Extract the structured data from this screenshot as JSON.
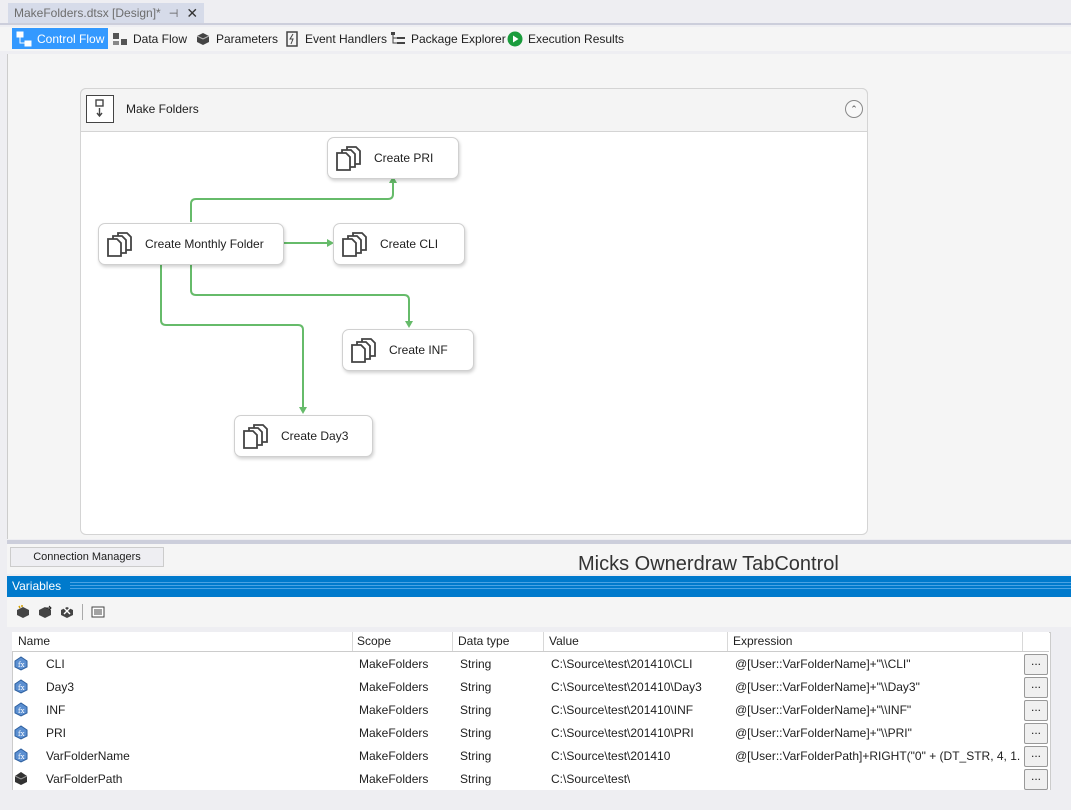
{
  "document": {
    "tab_title": "MakeFolders.dtsx [Design]*",
    "pin_glyph": "⊣",
    "close_glyph": "✕"
  },
  "designer_tabs": [
    {
      "label": "Control Flow",
      "icon": "control-flow-icon",
      "active": true
    },
    {
      "label": "Data Flow",
      "icon": "data-flow-icon"
    },
    {
      "label": "Parameters",
      "icon": "parameters-icon"
    },
    {
      "label": "Event Handlers",
      "icon": "event-handlers-icon"
    },
    {
      "label": "Package Explorer",
      "icon": "package-explorer-icon"
    },
    {
      "label": "Execution Results",
      "icon": "execution-results-icon"
    }
  ],
  "container": {
    "title": "Make Folders",
    "collapse_glyph": "⌃"
  },
  "tasks": [
    {
      "label": "Create PRI"
    },
    {
      "label": "Create Monthly Folder"
    },
    {
      "label": "Create CLI"
    },
    {
      "label": "Create INF"
    },
    {
      "label": "Create Day3"
    }
  ],
  "colors": {
    "accent": "#007acc",
    "active_tab": "#3399ff",
    "precedence_arrow": "#66bb6a"
  },
  "connection_managers": {
    "tab_label": "Connection Managers",
    "overlay_text": "Micks Ownerdraw TabControl"
  },
  "variables": {
    "panel_title": "Variables",
    "columns": [
      "Name",
      "Scope",
      "Data type",
      "Value",
      "Expression"
    ],
    "rows": [
      {
        "name": "CLI",
        "scope": "MakeFolders",
        "type": "String",
        "value": "C:\\Source\\test\\201410\\CLI",
        "expression": "@[User::VarFolderName]+\"\\\\CLI\"",
        "icon": "expression-variable-icon",
        "button": "..."
      },
      {
        "name": "Day3",
        "scope": "MakeFolders",
        "type": "String",
        "value": "C:\\Source\\test\\201410\\Day3",
        "expression": "@[User::VarFolderName]+\"\\\\Day3\"",
        "icon": "expression-variable-icon",
        "button": "..."
      },
      {
        "name": "INF",
        "scope": "MakeFolders",
        "type": "String",
        "value": "C:\\Source\\test\\201410\\INF",
        "expression": "@[User::VarFolderName]+\"\\\\INF\"",
        "icon": "expression-variable-icon",
        "button": "..."
      },
      {
        "name": "PRI",
        "scope": "MakeFolders",
        "type": "String",
        "value": "C:\\Source\\test\\201410\\PRI",
        "expression": "@[User::VarFolderName]+\"\\\\PRI\"",
        "icon": "expression-variable-icon",
        "button": "..."
      },
      {
        "name": "VarFolderName",
        "scope": "MakeFolders",
        "type": "String",
        "value": "C:\\Source\\test\\201410",
        "expression": "@[User::VarFolderPath]+RIGHT(\"0\" + (DT_STR, 4, 1...",
        "icon": "expression-variable-icon",
        "button": "..."
      },
      {
        "name": "VarFolderPath",
        "scope": "MakeFolders",
        "type": "String",
        "value": "C:\\Source\\test\\",
        "expression": "",
        "icon": "variable-icon",
        "button": "..."
      }
    ]
  }
}
